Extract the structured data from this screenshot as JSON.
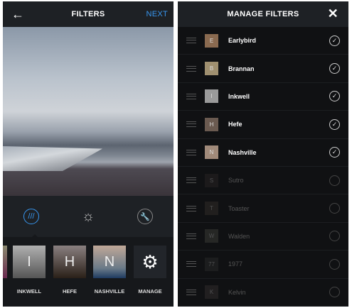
{
  "left": {
    "title": "FILTERS",
    "next_label": "NEXT",
    "back_icon": "arrow-left-icon",
    "tools": [
      {
        "name": "filter-icon",
        "active": true
      },
      {
        "name": "brightness-icon"
      },
      {
        "name": "wrench-icon"
      }
    ],
    "filters": [
      {
        "label": "",
        "letter": ""
      },
      {
        "label": "INKWELL",
        "letter": "I"
      },
      {
        "label": "HEFE",
        "letter": "H"
      },
      {
        "label": "NASHVILLE",
        "letter": "N"
      },
      {
        "label": "MANAGE",
        "icon": "gear-icon"
      }
    ],
    "accent": "#3897f0"
  },
  "right": {
    "title": "MANAGE FILTERS",
    "close_icon": "close-icon",
    "items": [
      {
        "name": "Earlybird",
        "letter": "E",
        "enabled": true
      },
      {
        "name": "Brannan",
        "letter": "B",
        "enabled": true
      },
      {
        "name": "Inkwell",
        "letter": "I",
        "enabled": true
      },
      {
        "name": "Hefe",
        "letter": "H",
        "enabled": true
      },
      {
        "name": "Nashville",
        "letter": "N",
        "enabled": true
      },
      {
        "name": "Sutro",
        "letter": "S",
        "enabled": false
      },
      {
        "name": "Toaster",
        "letter": "T",
        "enabled": false
      },
      {
        "name": "Walden",
        "letter": "W",
        "enabled": false
      },
      {
        "name": "1977",
        "letter": "77",
        "enabled": false
      },
      {
        "name": "Kelvin",
        "letter": "K",
        "enabled": false
      }
    ]
  }
}
